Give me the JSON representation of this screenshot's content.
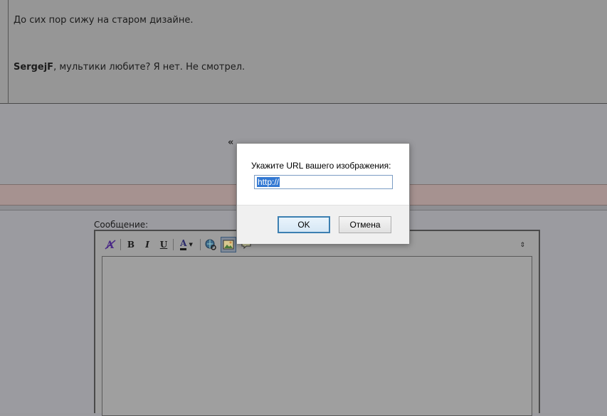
{
  "post": {
    "line1": "До сих пор сижу на старом дизайне.",
    "faint": "",
    "reply_name": "SergejF",
    "reply_text": ", мультики любите? Я нет. Не смотрел."
  },
  "nav": {
    "raquo": "«"
  },
  "editor": {
    "label": "Сообщение:",
    "toolbar": {
      "bold": "B",
      "italic": "I",
      "underline": "U",
      "font_color": "A",
      "resize": "⇕"
    }
  },
  "dialog": {
    "prompt": "Укажите URL вашего изображения:",
    "input_value": "http://",
    "ok_label": "OK",
    "cancel_label": "Отмена"
  },
  "colors": {
    "overlay": "#9a9a9e",
    "dialog_bg": "#ffffff",
    "selection": "#3379d3",
    "ok_border": "#3c7fb1"
  }
}
